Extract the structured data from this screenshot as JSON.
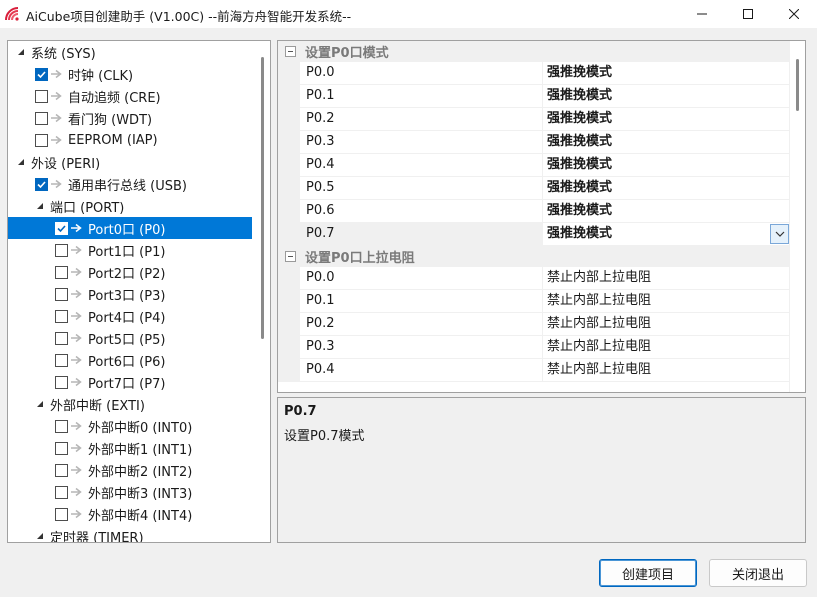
{
  "window": {
    "title": "AiCube项目创建助手 (V1.00C) --前海方舟智能开发系统--",
    "icon": "aicube-logo-icon",
    "controls": [
      "minimize-icon",
      "maximize-icon",
      "close-icon"
    ]
  },
  "tree": {
    "items": [
      {
        "label": "系统 (SYS)",
        "level": 0,
        "type": "group",
        "expanded": true
      },
      {
        "label": "时钟 (CLK)",
        "level": 1,
        "checked": true
      },
      {
        "label": "自动追频 (CRE)",
        "level": 1,
        "checked": false
      },
      {
        "label": "看门狗 (WDT)",
        "level": 1,
        "checked": false
      },
      {
        "label": "EEPROM (IAP)",
        "level": 1,
        "checked": false
      },
      {
        "label": "外设 (PERI)",
        "level": 0,
        "type": "group",
        "expanded": true
      },
      {
        "label": "通用串行总线 (USB)",
        "level": 1,
        "checked": true
      },
      {
        "label": "端口 (PORT)",
        "level": 1,
        "type": "group",
        "expanded": true
      },
      {
        "label": "Port0口 (P0)",
        "level": 2,
        "checked": true,
        "selected": true
      },
      {
        "label": "Port1口 (P1)",
        "level": 2,
        "checked": false
      },
      {
        "label": "Port2口 (P2)",
        "level": 2,
        "checked": false
      },
      {
        "label": "Port3口 (P3)",
        "level": 2,
        "checked": false
      },
      {
        "label": "Port4口 (P4)",
        "level": 2,
        "checked": false
      },
      {
        "label": "Port5口 (P5)",
        "level": 2,
        "checked": false
      },
      {
        "label": "Port6口 (P6)",
        "level": 2,
        "checked": false
      },
      {
        "label": "Port7口 (P7)",
        "level": 2,
        "checked": false
      },
      {
        "label": "外部中断 (EXTI)",
        "level": 1,
        "type": "group",
        "expanded": true
      },
      {
        "label": "外部中断0 (INT0)",
        "level": 2,
        "checked": false
      },
      {
        "label": "外部中断1 (INT1)",
        "level": 2,
        "checked": false
      },
      {
        "label": "外部中断2 (INT2)",
        "level": 2,
        "checked": false
      },
      {
        "label": "外部中断3 (INT3)",
        "level": 2,
        "checked": false
      },
      {
        "label": "外部中断4 (INT4)",
        "level": 2,
        "checked": false
      },
      {
        "label": "定时器 (TIMER)",
        "level": 1,
        "type": "group",
        "expanded": true
      }
    ]
  },
  "grid": {
    "categories": [
      {
        "title": "设置P0口模式",
        "rows": [
          {
            "name": "P0.0",
            "value": "强推挽模式",
            "bold": true
          },
          {
            "name": "P0.1",
            "value": "强推挽模式",
            "bold": true
          },
          {
            "name": "P0.2",
            "value": "强推挽模式",
            "bold": true
          },
          {
            "name": "P0.3",
            "value": "强推挽模式",
            "bold": true
          },
          {
            "name": "P0.4",
            "value": "强推挽模式",
            "bold": true
          },
          {
            "name": "P0.5",
            "value": "强推挽模式",
            "bold": true
          },
          {
            "name": "P0.6",
            "value": "强推挽模式",
            "bold": true
          },
          {
            "name": "P0.7",
            "value": "强推挽模式",
            "bold": true,
            "active": true
          }
        ]
      },
      {
        "title": "设置P0口上拉电阻",
        "rows": [
          {
            "name": "P0.0",
            "value": "禁止内部上拉电阻",
            "bold": false
          },
          {
            "name": "P0.1",
            "value": "禁止内部上拉电阻",
            "bold": false
          },
          {
            "name": "P0.2",
            "value": "禁止内部上拉电阻",
            "bold": false
          },
          {
            "name": "P0.3",
            "value": "禁止内部上拉电阻",
            "bold": false
          },
          {
            "name": "P0.4",
            "value": "禁止内部上拉电阻",
            "bold": false
          }
        ]
      }
    ]
  },
  "description": {
    "title": "P0.7",
    "text": "设置P0.7模式"
  },
  "buttons": {
    "create": "创建项目",
    "close": "关闭退出"
  },
  "colors": {
    "selection": "#0078d7",
    "check": "#0067c0",
    "window_bg": "#f0f0f0"
  }
}
